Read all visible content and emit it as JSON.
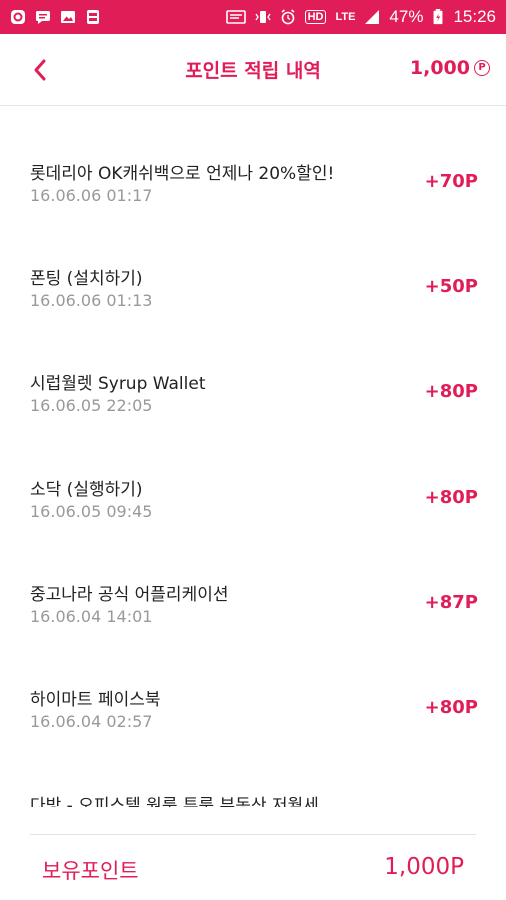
{
  "status_bar": {
    "battery_percent": "47%",
    "time": "15:26",
    "network": "LTE",
    "hd_label": "HD",
    "background_color": "#e11d57"
  },
  "header": {
    "title": "포인트 적립 내역",
    "points": "1,000",
    "points_unit_symbol": "P",
    "accent_color": "#e11d57"
  },
  "list": {
    "items": [
      {
        "title": "롯데리아 OK캐쉬백으로 언제나 20%할인!",
        "date": "16.06.06 01:17",
        "points": "+70P"
      },
      {
        "title": "폰팅 (설치하기)",
        "date": "16.06.06 01:13",
        "points": "+50P"
      },
      {
        "title": "시럽월렛 Syrup Wallet",
        "date": "16.06.05 22:05",
        "points": "+80P"
      },
      {
        "title": "소닥 (실행하기)",
        "date": "16.06.05 09:45",
        "points": "+80P"
      },
      {
        "title": "중고나라 공식 어플리케이션",
        "date": "16.06.04 14:01",
        "points": "+87P"
      },
      {
        "title": "하이마트 페이스북",
        "date": "16.06.04 02:57",
        "points": "+80P"
      },
      {
        "title": "다방 - 오피스텔 원룸 투룸 부동산 저월세",
        "date": "",
        "points": ""
      }
    ]
  },
  "footer": {
    "label": "보유포인트",
    "value": "1,000P"
  }
}
